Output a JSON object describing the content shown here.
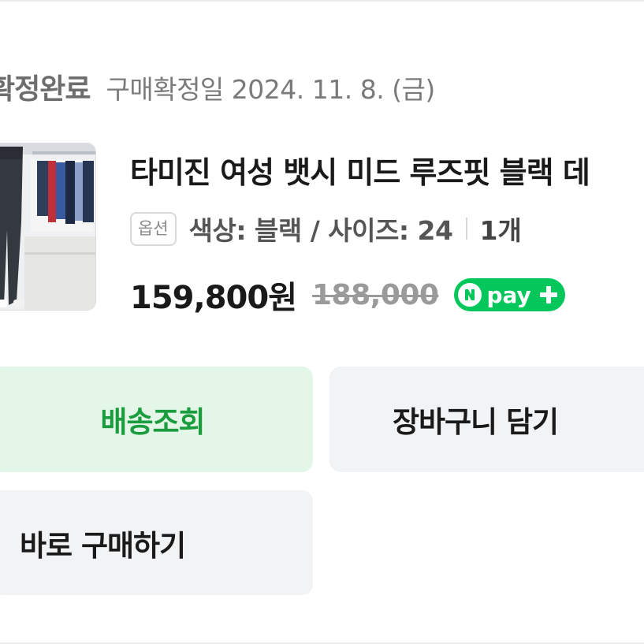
{
  "order": {
    "status_title": "확정완료",
    "confirm_date": "구매확정일 2024. 11. 8. (금)"
  },
  "product": {
    "title": "타미진 여성 뱃시 미드 루즈핏 블랙 데",
    "option_label": "옵션",
    "option_value": "색상: 블랙 / 사이즈: 24",
    "quantity": "1개",
    "sale_price": "159,800원",
    "original_price": "188,000",
    "pay_badge": "pay"
  },
  "buttons": {
    "track": "배송조회",
    "cart": "장바구니 담기",
    "buy": "바로 구매하기"
  },
  "colors": {
    "npay_green": "#03c75a",
    "track_text": "#1b9c3f",
    "track_bg": "#e3f6e7",
    "button_bg": "#f2f3f5"
  }
}
